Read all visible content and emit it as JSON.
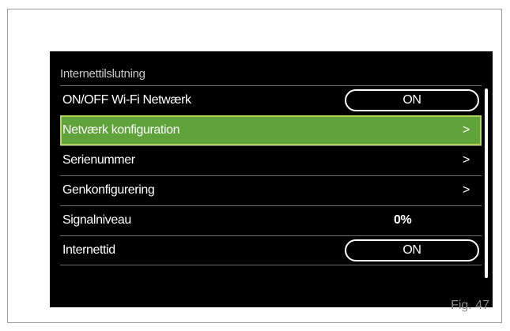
{
  "header": {
    "title": "Internettilslutning"
  },
  "menu": {
    "items": [
      {
        "label": "ON/OFF Wi-Fi Netwærk",
        "toggle": "ON"
      },
      {
        "label": "Netværk konfiguration",
        "arrow": ">"
      },
      {
        "label": "Serienummer",
        "arrow": ">"
      },
      {
        "label": "Genkonfigurering",
        "arrow": ">"
      },
      {
        "label": "Signalniveau",
        "value": "0%"
      },
      {
        "label": "Internettid",
        "toggle": "ON"
      }
    ]
  },
  "caption": "Fig. 47",
  "colors": {
    "selected": "#5fa33a",
    "selected_border": "#b6d35b",
    "background": "#000000"
  }
}
